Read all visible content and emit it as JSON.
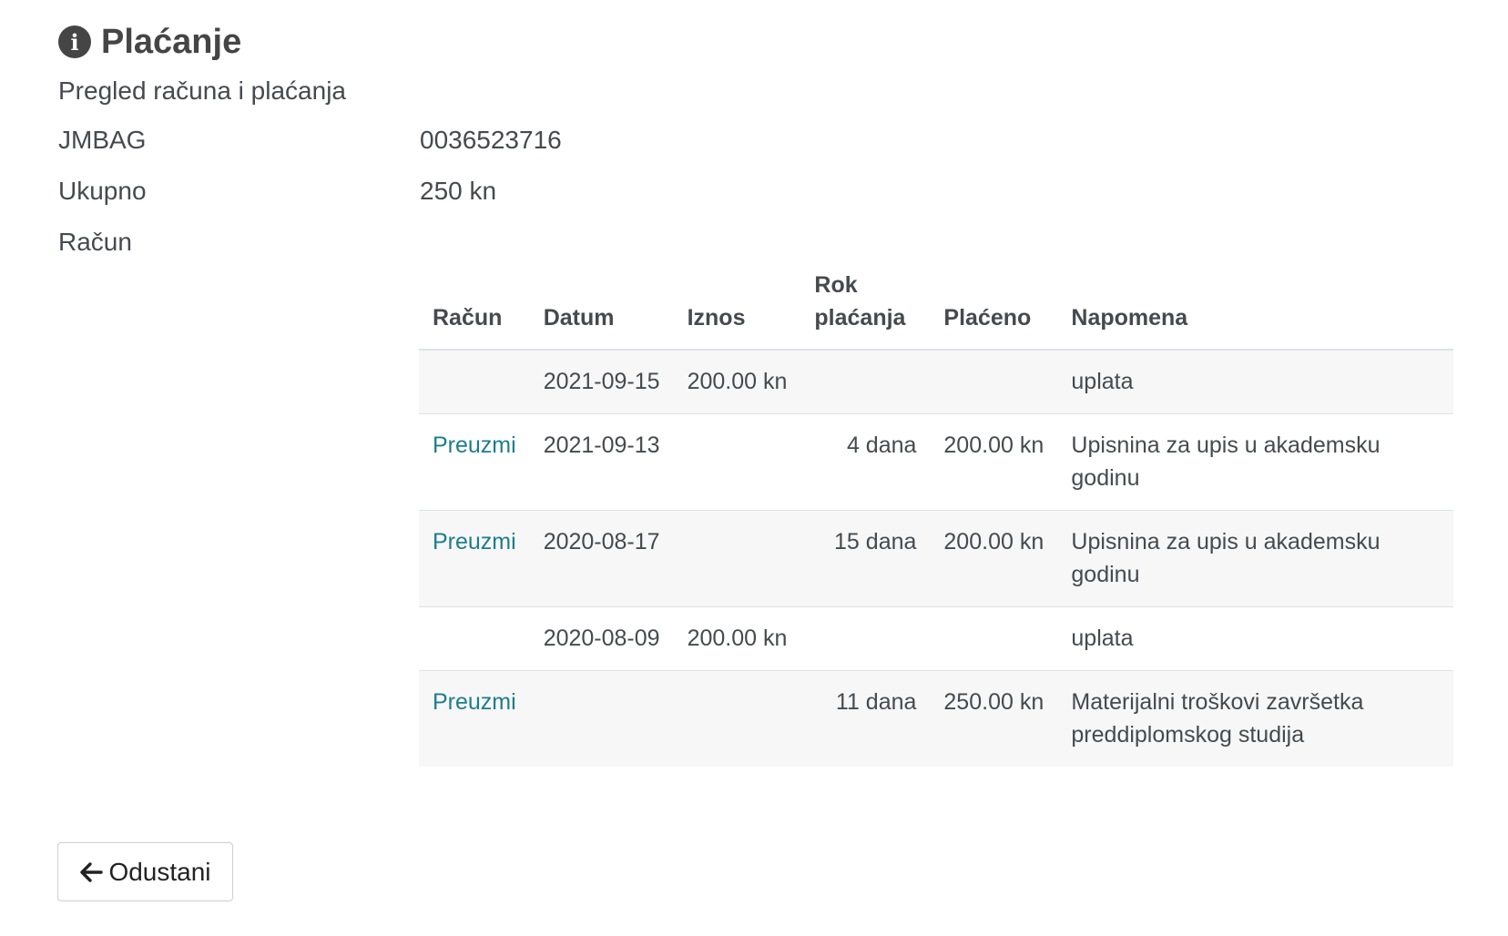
{
  "header": {
    "title": "Plaćanje",
    "icon": "info-circle-icon",
    "subtitle": "Pregled računa i plaćanja"
  },
  "fields": {
    "jmbag_label": "JMBAG",
    "jmbag_value": "0036523716",
    "total_label": "Ukupno",
    "total_value": "250 kn",
    "invoice_label": "Račun"
  },
  "table": {
    "headers": {
      "invoice": "Račun",
      "date": "Datum",
      "amount": "Iznos",
      "due": "Rok plaćanja",
      "paid": "Plaćeno",
      "note": "Napomena"
    },
    "rows": [
      {
        "invoice": "",
        "date": "2021-09-15",
        "amount": "200.00 kn",
        "due": "",
        "paid": "",
        "note": "uplata"
      },
      {
        "invoice": "Preuzmi",
        "date": "2021-09-13",
        "amount": "",
        "due": "4 dana",
        "paid": "200.00 kn",
        "note": "Upisnina za upis u akademsku godinu"
      },
      {
        "invoice": "Preuzmi",
        "date": "2020-08-17",
        "amount": "",
        "due": "15 dana",
        "paid": "200.00 kn",
        "note": "Upisnina za upis u akademsku godinu"
      },
      {
        "invoice": "",
        "date": "2020-08-09",
        "amount": "200.00 kn",
        "due": "",
        "paid": "",
        "note": "uplata"
      },
      {
        "invoice": "Preuzmi",
        "date": "",
        "amount": "",
        "due": "11 dana",
        "paid": "250.00 kn",
        "note": "Materijalni troškovi završetka preddiplomskog studija"
      }
    ]
  },
  "actions": {
    "cancel_label": "Odustani",
    "cancel_icon": "arrow-left-icon"
  },
  "colors": {
    "link": "#1e7d8c",
    "text": "#464a4e",
    "stripe": "#f7f7f7",
    "border": "#dee2e6"
  }
}
